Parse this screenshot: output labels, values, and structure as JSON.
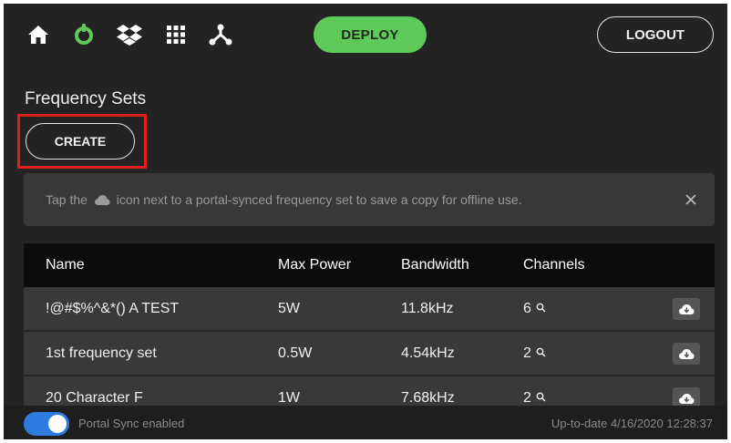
{
  "nav": {
    "icons": [
      "home-icon",
      "power-icon",
      "dropbox-icon",
      "grid-icon",
      "network-icon"
    ],
    "power_icon_color": "#5fc95a",
    "deploy_label": "DEPLOY",
    "logout_label": "LOGOUT"
  },
  "page": {
    "title": "Frequency Sets",
    "create_label": "CREATE"
  },
  "banner": {
    "text_before": "Tap the",
    "text_after": "icon next to a portal-synced frequency set to save a copy for offline use.",
    "icon": "cloud-icon"
  },
  "table": {
    "headers": {
      "name": "Name",
      "max_power": "Max Power",
      "bandwidth": "Bandwidth",
      "channels": "Channels"
    },
    "rows": [
      {
        "name": "!@#$%^&*() A TEST",
        "max_power": "5W",
        "bandwidth": "11.8kHz",
        "channels": "6"
      },
      {
        "name": "1st frequency set",
        "max_power": "0.5W",
        "bandwidth": "4.54kHz",
        "channels": "2"
      },
      {
        "name": "20 Character F",
        "max_power": "1W",
        "bandwidth": "7.68kHz",
        "channels": "2"
      }
    ]
  },
  "footer": {
    "sync_label": "Portal Sync enabled",
    "sync_enabled": true,
    "status": "Up-to-date 4/16/2020 12:28:37"
  },
  "colors": {
    "background": "#232323",
    "accent_green": "#5fc95a",
    "toggle_blue": "#2d7de0",
    "highlight_red": "#e0201f"
  }
}
